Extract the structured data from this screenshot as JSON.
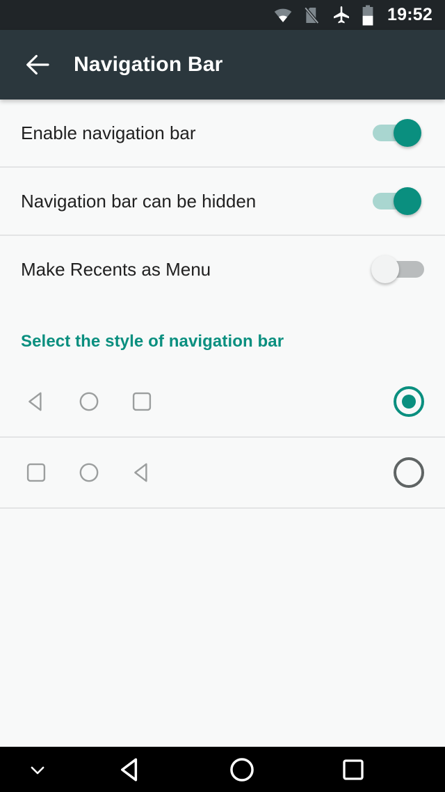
{
  "status_bar": {
    "background": "#202528",
    "time": "19:52",
    "icons": [
      {
        "name": "wifi-icon",
        "label": "Wi-Fi"
      },
      {
        "name": "sim-card-off-icon",
        "label": "No SIM card"
      },
      {
        "name": "airplane-mode-icon",
        "label": "Airplane mode"
      },
      {
        "name": "battery-icon",
        "label": "Battery"
      }
    ]
  },
  "app_bar": {
    "background": "#2b373d",
    "title": "Navigation Bar",
    "back_label": "Navigate up"
  },
  "preferences": [
    {
      "label": "Enable navigation bar",
      "switch_state": "on"
    },
    {
      "label": "Navigation bar can be hidden",
      "switch_state": "on"
    },
    {
      "label": "Make Recents as Menu",
      "switch_state": "off"
    }
  ],
  "style_section": {
    "header": "Select the style of navigation bar",
    "header_color": "#0a8f7f",
    "options": [
      {
        "icons": [
          "back-icon",
          "home-icon",
          "recents-icon"
        ],
        "selected": true
      },
      {
        "icons": [
          "recents-icon",
          "home-icon",
          "back-icon"
        ],
        "selected": false
      }
    ]
  },
  "nav_bar": {
    "background": "#000000",
    "buttons": [
      {
        "name": "ime-hide-icon",
        "label": "Hide keyboard"
      },
      {
        "name": "back-icon",
        "label": "Back"
      },
      {
        "name": "home-icon",
        "label": "Home"
      },
      {
        "name": "recents-icon",
        "label": "Recents"
      }
    ]
  }
}
